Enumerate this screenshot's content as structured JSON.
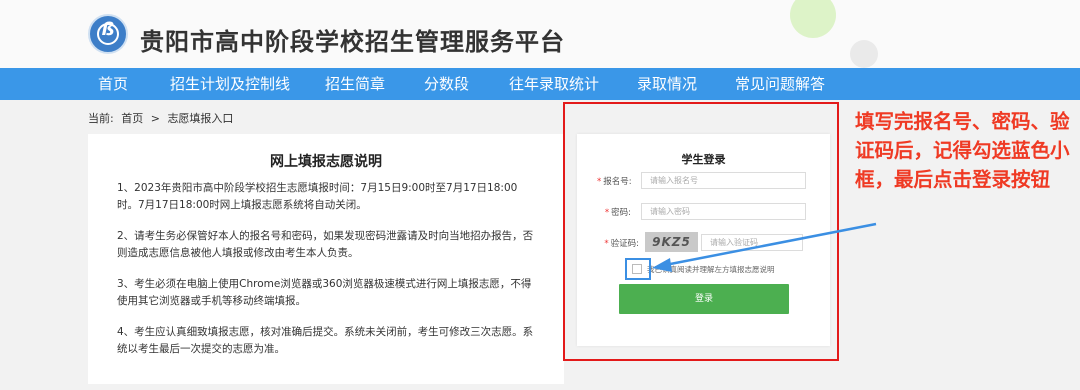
{
  "header": {
    "logo_letter": "ß",
    "title": "贵阳市高中阶段学校招生管理服务平台"
  },
  "nav": {
    "items": [
      "首页",
      "招生计划及控制线",
      "招生简章",
      "分数段",
      "往年录取统计",
      "录取情况",
      "常见问题解答"
    ]
  },
  "breadcrumb": {
    "prefix": "当前:",
    "home": "首页",
    "separator": ">",
    "current": "志愿填报入口"
  },
  "instructions": {
    "title": "网上填报志愿说明",
    "paragraphs": [
      "1、2023年贵阳市高中阶段学校招生志愿填报时间：7月15日9:00时至7月17日18:00时。7月17日18:00时网上填报志愿系统将自动关闭。",
      "2、请考生务必保管好本人的报名号和密码，如果发现密码泄露请及时向当地招办报告，否则造成志愿信息被他人填报或修改由考生本人负责。",
      "3、考生必须在电脑上使用Chrome浏览器或360浏览器极速模式进行网上填报志愿，不得使用其它浏览器或手机等移动终端填报。",
      "4、考生应认真细致填报志愿，核对准确后提交。系统未关闭前，考生可修改三次志愿。系统以考生最后一次提交的志愿为准。"
    ]
  },
  "login": {
    "title": "学生登录",
    "required_mark": "*",
    "reg_label": "报名号:",
    "reg_placeholder": "请输入报名号",
    "pwd_label": "密码:",
    "pwd_placeholder": "请输入密码",
    "captcha_label": "验证码:",
    "captcha_text": "9KZ5",
    "captcha_placeholder": "请输入验证码",
    "agree_text": "我已认真阅读并理解左方填报志愿说明",
    "button": "登录"
  },
  "annotation": {
    "text": "填写完报名号、密码、验证码后，记得勾选蓝色小框，最后点击登录按钮"
  },
  "colors": {
    "nav_bg": "#3a97e8",
    "login_button": "#4caf50",
    "annotation_red": "#ef3a24",
    "highlight_blue": "#3b8fe3"
  }
}
